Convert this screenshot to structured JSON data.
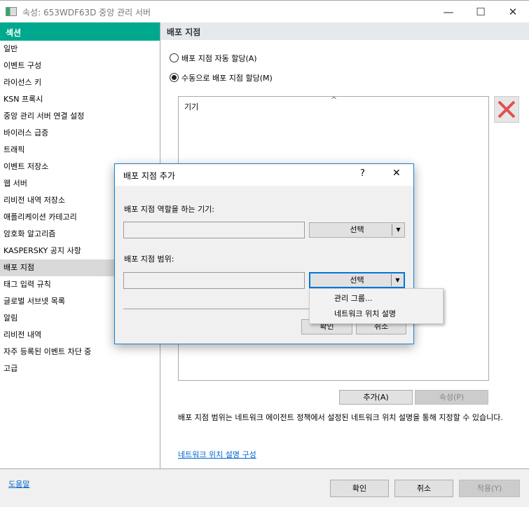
{
  "window": {
    "title": "속성: 653WDF63D 중앙 관리 서버",
    "minimize": "—",
    "maximize": "☐",
    "close": "✕"
  },
  "sidebar": {
    "header": "섹션",
    "items": [
      "일반",
      "이벤트 구성",
      "라이선스 키",
      "KSN 프록시",
      "중앙 관리 서버 연결 설정",
      "바이러스 급증",
      "트래픽",
      "이벤트 저장소",
      "웹 서버",
      "리비전 내역 저장소",
      "애플리케이션 카테고리",
      "암호화 알고리즘",
      "KASPERSKY 공지 사항",
      "배포 지점",
      "태그 입력 규칙",
      "글로벌 서브넷 목록",
      "알림",
      "리비전 내역",
      "자주 등록된 이벤트 차단 중",
      "고급"
    ],
    "selected": "배포 지점"
  },
  "main": {
    "header": "배포 지점",
    "radio_auto": "배포 지점 자동 할당(A)",
    "radio_manual": "수동으로 배포 지점 할당(M)",
    "selected_radio": "manual",
    "list_column": "기기",
    "sort_icon": "^",
    "add_button": "추가(A)",
    "props_button": "속성(P)",
    "info": "배포 지점 범위는 네트워크 에이전트 정책에서 설정된 네트워크 위치 설명을 통해 지정할 수 있습니다.",
    "link": "네트워크 위치 설명 구성",
    "delete_color": "#e05050"
  },
  "footer": {
    "help": "도움말",
    "ok": "확인",
    "cancel": "취소",
    "apply": "적용(Y)"
  },
  "dialog": {
    "title": "배포 지점 추가",
    "help": "?",
    "close": "✕",
    "device_label": "배포 지점 역할을 하는 기기:",
    "device_value": "",
    "select1": "선택",
    "scope_label": "배포 지점 범위:",
    "scope_value": "",
    "select2": "선택",
    "ok": "확인",
    "cancel": "취소",
    "menu": [
      "관리 그룹...",
      "네트워크 위치 설명"
    ]
  }
}
